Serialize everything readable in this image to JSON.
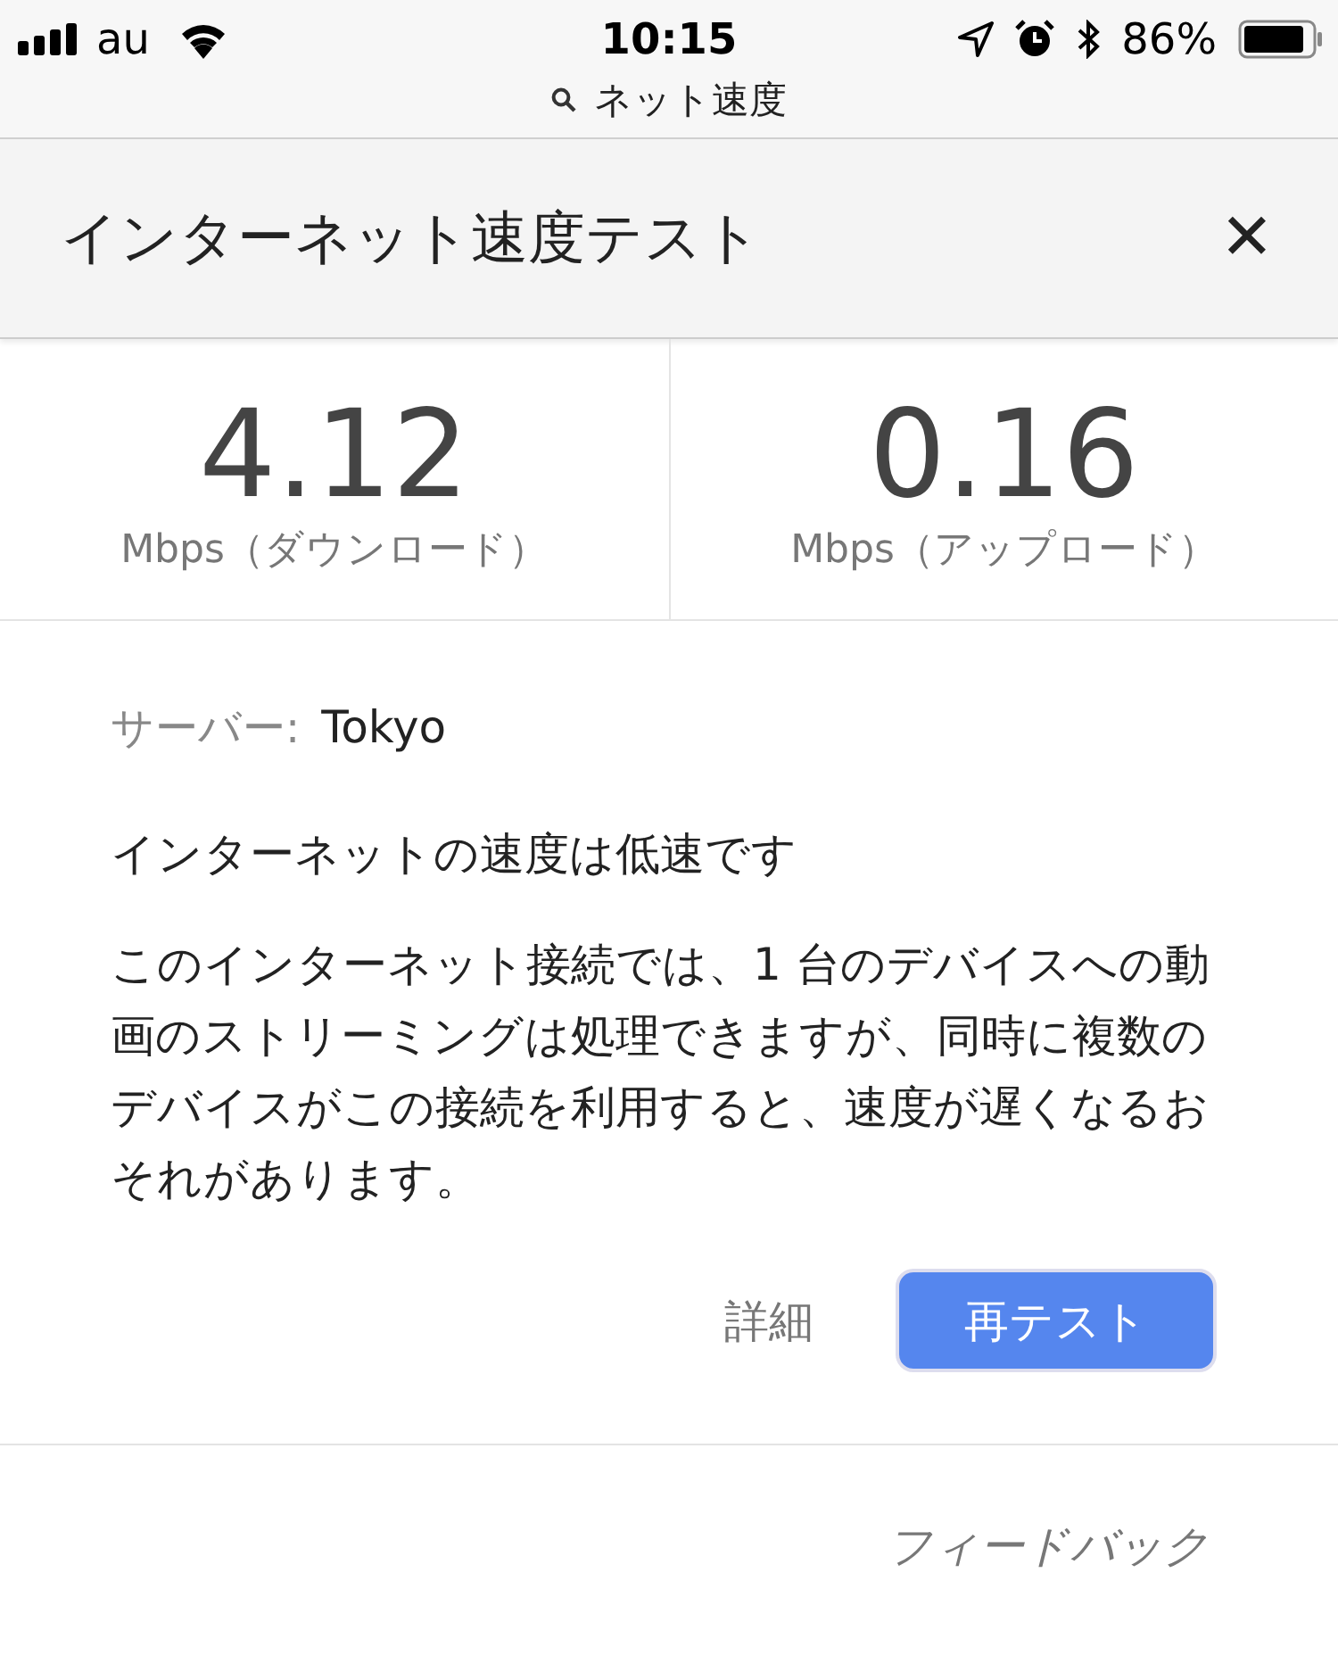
{
  "status_bar": {
    "carrier": "au",
    "time": "10:15",
    "battery": "86%"
  },
  "address_bar": {
    "query": "ネット速度"
  },
  "header": {
    "title": "インターネット速度テスト",
    "close": "✕"
  },
  "results": [
    {
      "value": "4.12",
      "unit": "Mbps（ダウンロード）"
    },
    {
      "value": "0.16",
      "unit": "Mbps（アップロード）"
    }
  ],
  "server": {
    "label": "サーバー:",
    "value": "Tokyo"
  },
  "verdict": "インターネットの速度は低速です",
  "description": "このインターネット接続では、1 台のデバイスへの動画のストリーミングは処理できますが、同時に複数のデバイスがこの接続を利用すると、速度が遅くなるおそれがあります。",
  "actions": {
    "details": "詳細",
    "retest": "再テスト"
  },
  "feedback": "フィードバック"
}
